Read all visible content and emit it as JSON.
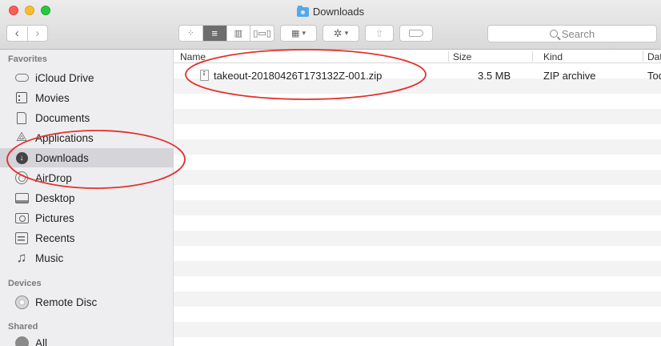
{
  "window": {
    "title": "Downloads"
  },
  "toolbar": {
    "back_glyph": "‹",
    "forward_glyph": "›",
    "view_modes": [
      "icon-view",
      "list-view",
      "column-view",
      "cover-flow-view"
    ],
    "active_view": "list-view",
    "search_placeholder": "Search"
  },
  "sidebar": {
    "favorites_title": "Favorites",
    "favorites": [
      {
        "label": "iCloud Drive",
        "icon": "cloud-icon"
      },
      {
        "label": "Movies",
        "icon": "film-icon"
      },
      {
        "label": "Documents",
        "icon": "document-icon"
      },
      {
        "label": "Applications",
        "icon": "applications-icon"
      },
      {
        "label": "Downloads",
        "icon": "download-icon",
        "selected": true
      },
      {
        "label": "AirDrop",
        "icon": "airdrop-icon"
      },
      {
        "label": "Desktop",
        "icon": "desktop-icon"
      },
      {
        "label": "Pictures",
        "icon": "camera-icon"
      },
      {
        "label": "Recents",
        "icon": "recents-icon"
      },
      {
        "label": "Music",
        "icon": "music-note-icon"
      }
    ],
    "devices_title": "Devices",
    "devices": [
      {
        "label": "Remote Disc",
        "icon": "disc-icon"
      }
    ],
    "shared_title": "Shared",
    "shared": [
      {
        "label": "All",
        "icon": "network-icon"
      }
    ]
  },
  "file_list": {
    "columns": [
      "Name",
      "Size",
      "Kind",
      "Date"
    ],
    "rows": [
      {
        "name": "takeout-20180426T173132Z-001.zip",
        "size": "3.5 MB",
        "kind": "ZIP archive",
        "date": "Toda"
      }
    ]
  },
  "annotations": {
    "color": "#e3312d"
  }
}
